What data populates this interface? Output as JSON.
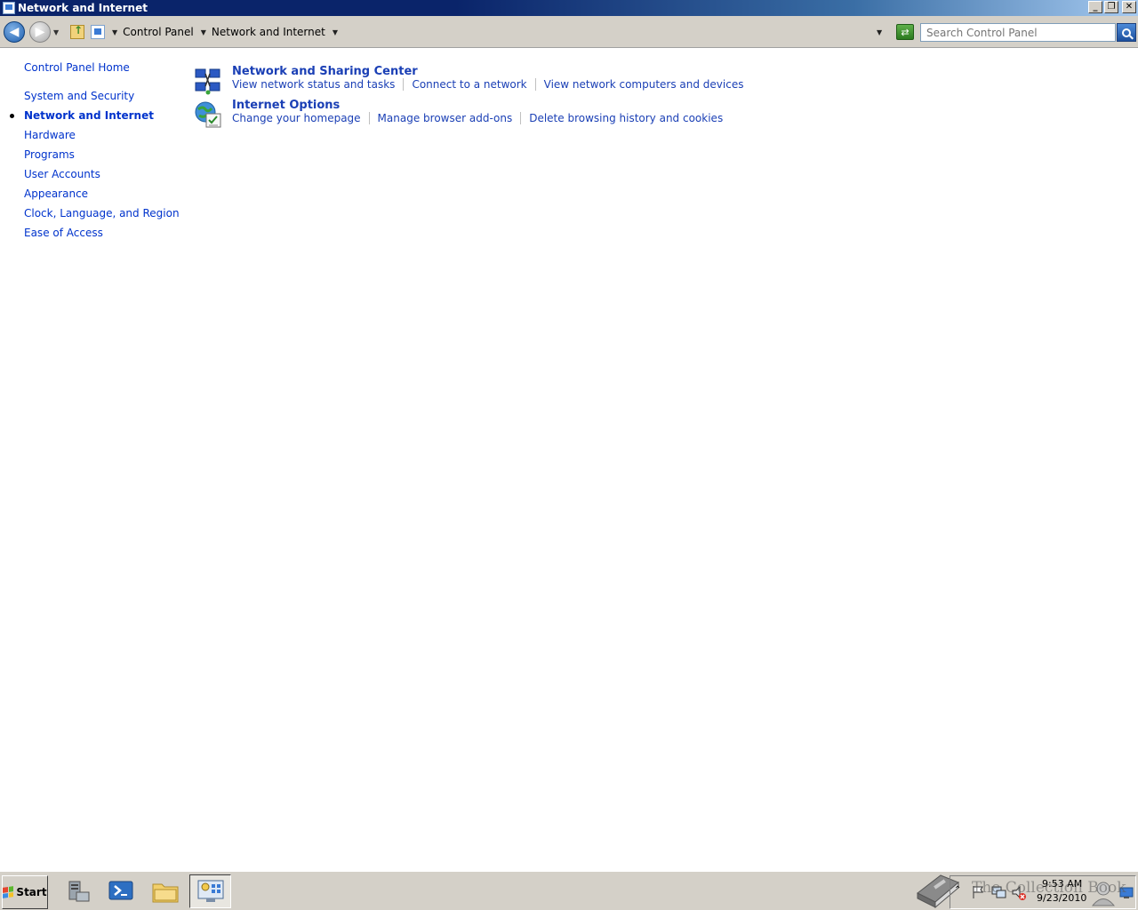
{
  "window": {
    "title": "Network and Internet",
    "buttons": {
      "minimize": "_",
      "restore": "❐",
      "close": "✕"
    }
  },
  "addressbar": {
    "breadcrumbs": [
      "Control Panel",
      "Network and Internet"
    ],
    "search_placeholder": "Search Control Panel"
  },
  "leftnav": {
    "items": [
      {
        "label": "Control Panel Home",
        "current": false
      },
      {
        "label": "System and Security",
        "current": false
      },
      {
        "label": "Network and Internet",
        "current": true
      },
      {
        "label": "Hardware",
        "current": false
      },
      {
        "label": "Programs",
        "current": false
      },
      {
        "label": "User Accounts",
        "current": false
      },
      {
        "label": "Appearance",
        "current": false
      },
      {
        "label": "Clock, Language, and Region",
        "current": false
      },
      {
        "label": "Ease of Access",
        "current": false
      }
    ]
  },
  "sections": [
    {
      "title": "Network and Sharing Center",
      "icon": "network-sharing-icon",
      "links": [
        "View network status and tasks",
        "Connect to a network",
        "View network computers and devices"
      ]
    },
    {
      "title": "Internet Options",
      "icon": "internet-options-icon",
      "links": [
        "Change your homepage",
        "Manage browser add-ons",
        "Delete browsing history and cookies"
      ]
    }
  ],
  "taskbar": {
    "start_label": "Start",
    "clock_time": "9:53 AM",
    "clock_date": "9/23/2010",
    "watermark": "The Collection Book"
  },
  "colors": {
    "link": "#1a3fb5",
    "nav_link": "#0033cc",
    "titlebar": "#0a246a",
    "chrome": "#d4d0c8"
  }
}
